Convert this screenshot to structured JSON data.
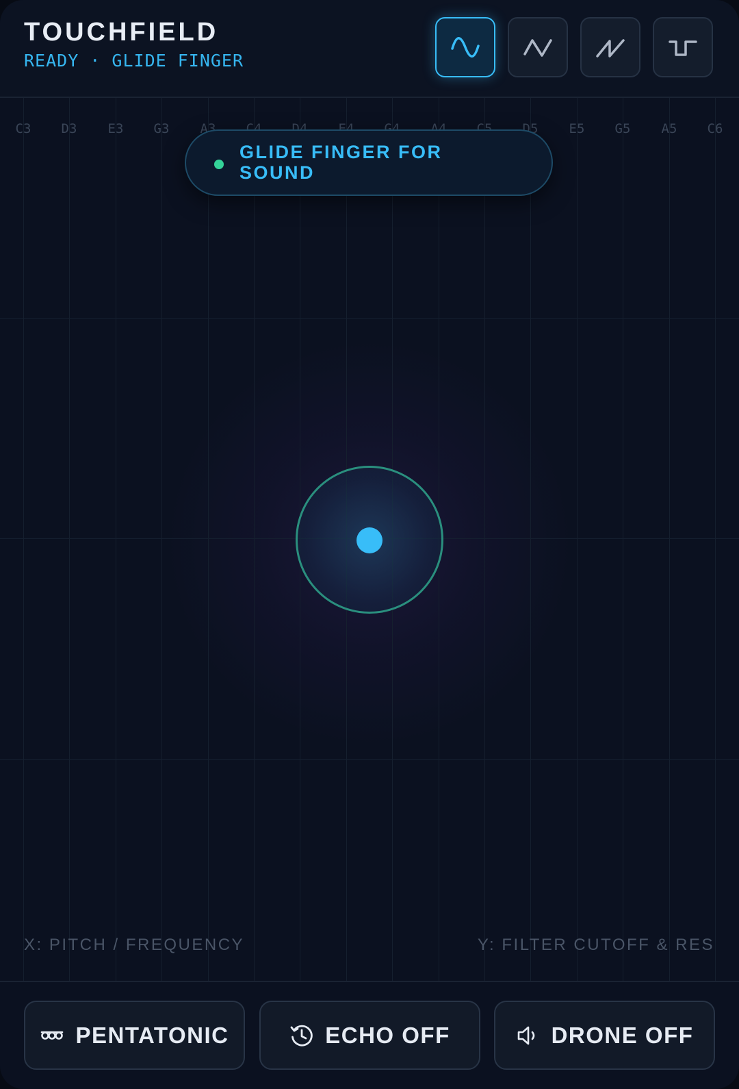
{
  "header": {
    "title": "TOUCHFIELD",
    "status": "READY · GLIDE FINGER"
  },
  "waveforms": [
    {
      "name": "sine",
      "icon": "sine-wave-icon",
      "active": true
    },
    {
      "name": "triangle",
      "icon": "triangle-wave-icon",
      "active": false
    },
    {
      "name": "sawtooth",
      "icon": "sawtooth-wave-icon",
      "active": false
    },
    {
      "name": "square",
      "icon": "square-wave-icon",
      "active": false
    }
  ],
  "field": {
    "notes": [
      "C3",
      "D3",
      "E3",
      "G3",
      "A3",
      "C4",
      "D4",
      "E4",
      "G4",
      "A4",
      "C5",
      "D5",
      "E5",
      "G5",
      "A5",
      "C6"
    ],
    "hint": "GLIDE FINGER FOR SOUND",
    "x_axis_label": "X: PITCH / FREQUENCY",
    "y_axis_label": "Y: FILTER CUTOFF & RES"
  },
  "footer": {
    "scale_label": "PENTATONIC",
    "echo_label": "ECHO OFF",
    "drone_label": "DRONE OFF"
  },
  "colors": {
    "accent": "#38bdf8",
    "ready_dot": "#34d399",
    "background": "#0b1120"
  }
}
